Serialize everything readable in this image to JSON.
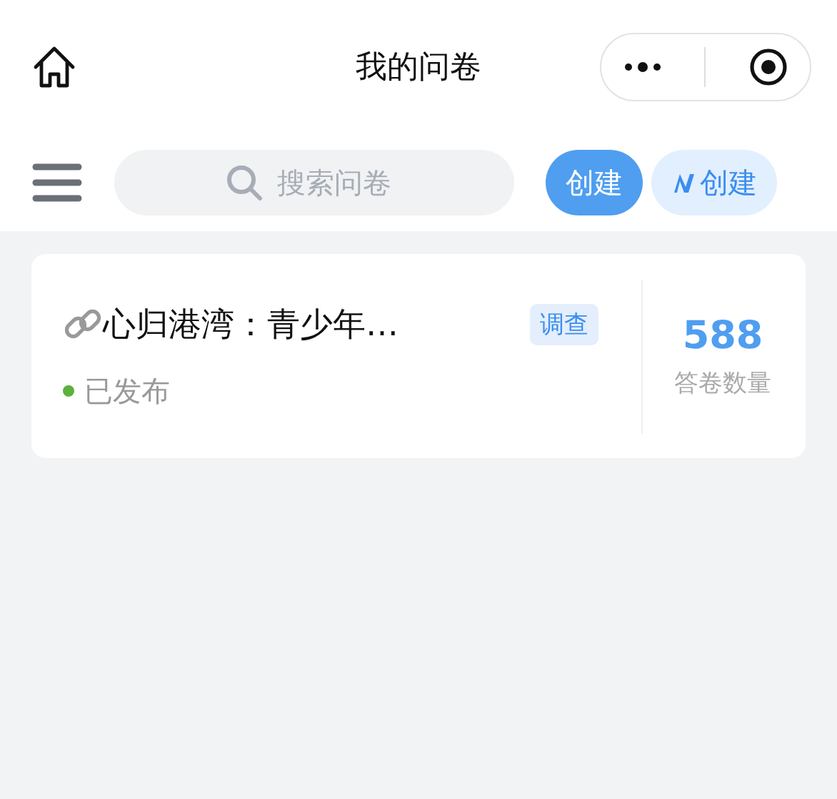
{
  "nav": {
    "title": "我的问卷"
  },
  "search": {
    "placeholder": "搜索问卷"
  },
  "buttons": [
    {
      "kind": "primary",
      "label": "创建"
    },
    {
      "kind": "ai",
      "label": "创建"
    }
  ],
  "surveys": [
    {
      "title": "心归港湾：青少年…",
      "tag": "调查",
      "status": "已发布",
      "color": "#5cb13a",
      "count": "588",
      "count_label": "答卷数量"
    }
  ]
}
